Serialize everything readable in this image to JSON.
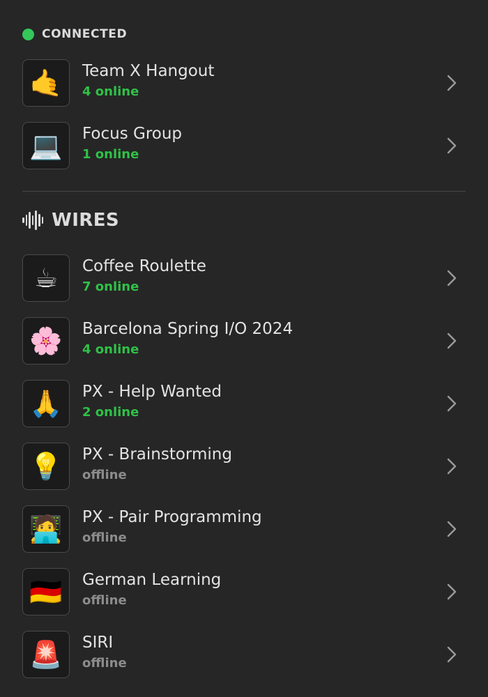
{
  "connected": {
    "label": "CONNECTED",
    "status_color": "#34c759",
    "items": [
      {
        "icon": "🤙",
        "icon_name": "call-me-hand-icon",
        "title": "Team X Hangout",
        "status": "4 online",
        "online": true
      },
      {
        "icon": "💻",
        "icon_name": "laptop-icon",
        "title": "Focus Group",
        "status": "1 online",
        "online": true
      }
    ]
  },
  "wires": {
    "label": "WIRES",
    "icon_name": "waveform-icon",
    "items": [
      {
        "icon": "☕",
        "icon_name": "coffee-cup-icon",
        "title": "Coffee Roulette",
        "status": "7 online",
        "online": true
      },
      {
        "icon": "🌸",
        "icon_name": "cherry-blossom-icon",
        "title": "Barcelona Spring I/O 2024",
        "status": "4 online",
        "online": true
      },
      {
        "icon": "🙏",
        "icon_name": "praying-hands-icon",
        "title": "PX - Help Wanted",
        "status": "2 online",
        "online": true
      },
      {
        "icon": "💡",
        "icon_name": "light-bulb-icon",
        "title": "PX - Brainstorming",
        "status": "offline",
        "online": false
      },
      {
        "icon": "🧑‍💻",
        "icon_name": "technologist-icon",
        "title": "PX - Pair Programming",
        "status": "offline",
        "online": false
      },
      {
        "icon": "🇩🇪",
        "icon_name": "german-flag-icon",
        "title": "German Learning",
        "status": "offline",
        "online": false
      },
      {
        "icon": "🚨",
        "icon_name": "siren-icon",
        "title": "SIRI",
        "status": "offline",
        "online": false
      }
    ]
  },
  "colors": {
    "background": "#262626",
    "online": "#30c148",
    "offline": "#8c8c8c"
  }
}
